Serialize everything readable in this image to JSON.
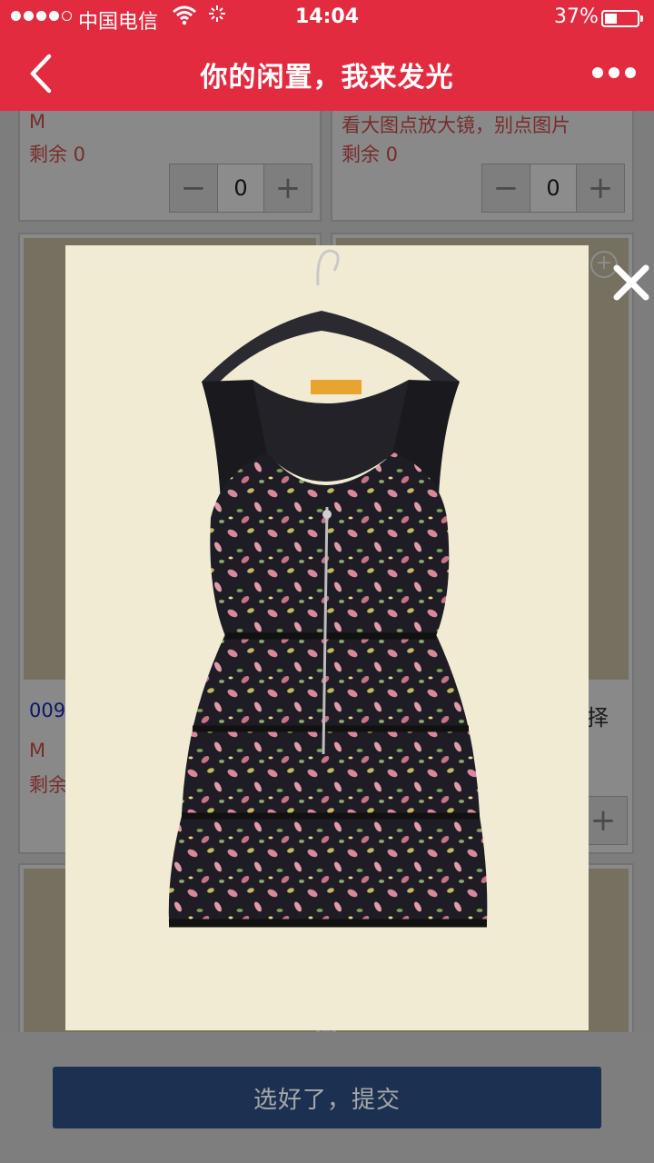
{
  "status_bar": {
    "carrier": "中国电信",
    "time": "14:04",
    "battery": "37%",
    "battery_level": 0.37
  },
  "nav": {
    "title": "你的闲置，我来发光"
  },
  "cards": {
    "c1": {
      "size": "M",
      "remaining": "剩余 0",
      "qty": "0",
      "minus": "−",
      "plus": "+"
    },
    "c2": {
      "note": "看大图点放大镜，别点图片",
      "remaining": "剩余 0",
      "qty": "0",
      "minus": "−",
      "plus": "+"
    },
    "c3": {
      "code": "009",
      "size": "M",
      "remaining": "剩余"
    },
    "c4": {
      "suffix": "择",
      "plus": "+"
    }
  },
  "footer": {
    "submit_label": "选好了，提交"
  },
  "colors": {
    "brand_red": "#e32b40",
    "submit_blue": "#2b4b7e",
    "preview_bg": "#f1ebd3"
  }
}
